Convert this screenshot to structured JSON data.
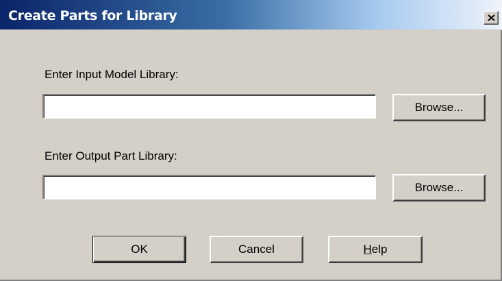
{
  "window": {
    "title": "Create Parts for Library",
    "close_icon": "close-icon"
  },
  "input_model": {
    "label": "Enter Input Model Library:",
    "value": "",
    "browse_label": "Browse..."
  },
  "output_part": {
    "label": "Enter Output Part Library:",
    "value": "",
    "browse_label": "Browse..."
  },
  "actions": {
    "ok_label": "OK",
    "cancel_label": "Cancel",
    "help_label": "Help"
  },
  "colors": {
    "dialog_face": "#d4d0c8",
    "titlebar_start": "#0a246a",
    "titlebar_end": "#eef3fb"
  }
}
